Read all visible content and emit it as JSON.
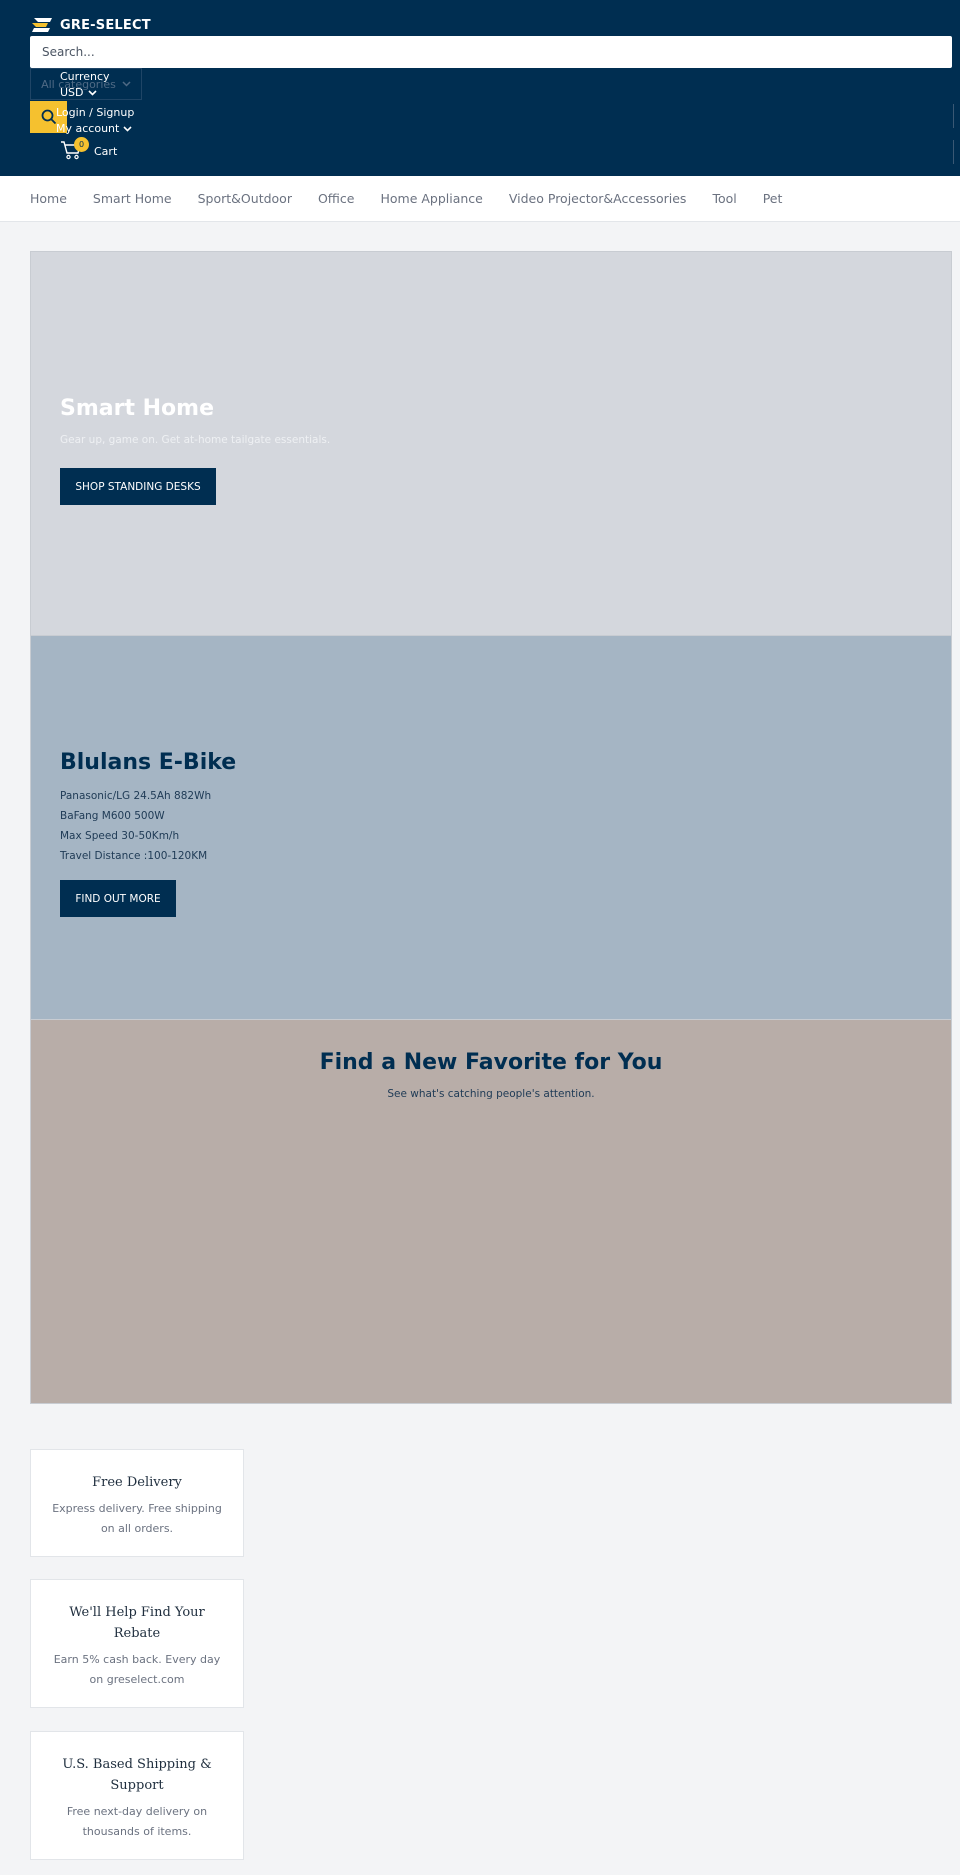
{
  "header": {
    "logo_text": "GRE-SELECT",
    "search_placeholder": "Search...",
    "category_label": "All categories",
    "currency_label": "Currency",
    "currency_value": "USD",
    "login_label": "Login / Signup",
    "account_label": "My account",
    "cart_label": "Cart",
    "cart_count": "0"
  },
  "nav": {
    "items": [
      "Home",
      "Smart Home",
      "Sport&Outdoor",
      "Office",
      "Home Appliance",
      "Video Projector&Accessories",
      "Tool",
      "Pet"
    ]
  },
  "slides": [
    {
      "title": "Smart Home",
      "subtitle": "Gear up, game on. Get at-home tailgate essentials.",
      "button": "SHOP STANDING DESKS"
    },
    {
      "title": "Blulans E-Bike",
      "lines": [
        "Panasonic/LG 24.5Ah 882Wh",
        "BaFang M600 500W",
        "Max Speed 30-50Km/h",
        "Travel Distance :100-120KM"
      ],
      "button": "FIND OUT MORE"
    },
    {
      "title": "Find a New Favorite for You",
      "subtitle": "See what's catching people's attention."
    }
  ],
  "features": [
    {
      "title": "Free Delivery",
      "text": "Express delivery. Free shipping on all orders."
    },
    {
      "title": "We'll Help Find Your Rebate",
      "text": "Earn 5% cash back. Every day on greselect.com"
    },
    {
      "title": "U.S. Based Shipping & Support",
      "text": "Free next-day delivery on thousands of items."
    }
  ],
  "colors": {
    "header_bg": "#002e51",
    "accent": "#f5c12f",
    "slide1_bg": "#d4d7dd",
    "slide2_bg": "#a5b5c4",
    "slide3_bg": "#b8ada8"
  },
  "icons": [
    "logo-icon",
    "search-icon",
    "chevron-down-icon",
    "cart-icon"
  ]
}
